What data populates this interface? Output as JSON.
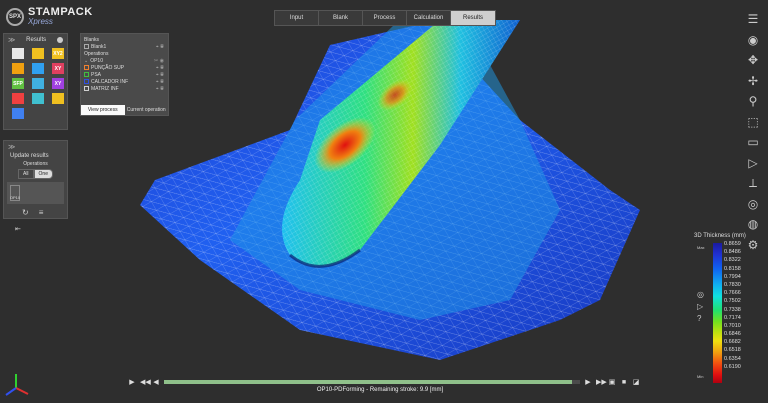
{
  "logo": {
    "main": "STAMPACK",
    "sub": "Xpress",
    "badge": "SPX"
  },
  "tabs": [
    {
      "label": "Input",
      "active": false
    },
    {
      "label": "Blank",
      "active": false
    },
    {
      "label": "Process",
      "active": false
    },
    {
      "label": "Calculation",
      "active": false
    },
    {
      "label": "Results",
      "active": true
    }
  ],
  "results_panel": {
    "title": "Results",
    "icons": [
      {
        "name": "bucket-icon",
        "color": "#e8e8e8",
        "text": ""
      },
      {
        "name": "bucket-color-icon",
        "color": "#f0c020",
        "text": ""
      },
      {
        "name": "xy-thickness-icon",
        "color": "#f0c020",
        "text": "XY2"
      },
      {
        "name": "thickness-icon",
        "color": "#f0a010",
        "text": ""
      },
      {
        "name": "strain-icon",
        "color": "#30a0f0",
        "text": ""
      },
      {
        "name": "xy-strain-icon",
        "color": "#e04060",
        "text": "XY"
      },
      {
        "name": "flc-icon",
        "color": "#60c040",
        "text": "SFP"
      },
      {
        "name": "stress-icon",
        "color": "#40b0e0",
        "text": ""
      },
      {
        "name": "xy-stress-icon",
        "color": "#a040e0",
        "text": "XY"
      },
      {
        "name": "wrinkle-icon",
        "color": "#f04040",
        "text": ""
      },
      {
        "name": "displacement-icon",
        "color": "#40c0d0",
        "text": ""
      },
      {
        "name": "vector-icon",
        "color": "#f0c020",
        "text": ""
      },
      {
        "name": "contact-icon",
        "color": "#4080f0",
        "text": ""
      }
    ]
  },
  "update_panel": {
    "title": "Update results",
    "operations_label": "Operations",
    "toggle_all": "All",
    "toggle_one": "One",
    "op_chip": "OP10"
  },
  "blank_panel": {
    "blanks_label": "Blanks",
    "blank1": "Blank1",
    "operations_label": "Operations",
    "op10": "OP10",
    "tools": [
      {
        "label": "PUNÇÃO SUP",
        "color": "#f08030"
      },
      {
        "label": "PSA",
        "color": "#40c040"
      },
      {
        "label": "CALCADOR INF",
        "color": "#3050e0"
      },
      {
        "label": "MATRIZ INF",
        "color": "#d0d0d0"
      }
    ],
    "tab_view": "View process",
    "tab_current": "Current operation"
  },
  "legend": {
    "title": "3D Thickness (mm)",
    "max_label": "Max",
    "min_label": "Min",
    "values": [
      "0.8659",
      "0.8486",
      "0.8322",
      "0.8158",
      "0.7994",
      "0.7830",
      "0.7666",
      "0.7502",
      "0.7338",
      "0.7174",
      "0.7010",
      "0.6846",
      "0.6682",
      "0.6518",
      "0.6354",
      "0.6190"
    ]
  },
  "bottom": {
    "status": "OP10-PDForming - Remaining stroke: 9.9 [mm]",
    "progress": 0.98
  },
  "right_toolbar": [
    {
      "name": "menu-icon",
      "glyph": "☰"
    },
    {
      "name": "view-eye-icon",
      "glyph": "◉"
    },
    {
      "name": "pan-icon",
      "glyph": "✥"
    },
    {
      "name": "move-icon",
      "glyph": "✢"
    },
    {
      "name": "zoom-icon",
      "glyph": "⚲"
    },
    {
      "name": "zoom-box-icon",
      "glyph": "⬚"
    },
    {
      "name": "ruler-icon",
      "glyph": "▭"
    },
    {
      "name": "select-icon",
      "glyph": "▷"
    },
    {
      "name": "section-icon",
      "glyph": "⟂"
    },
    {
      "name": "render-icon",
      "glyph": "◎"
    },
    {
      "name": "shade-icon",
      "glyph": "◍"
    },
    {
      "name": "settings-icon",
      "glyph": "⚙"
    }
  ]
}
